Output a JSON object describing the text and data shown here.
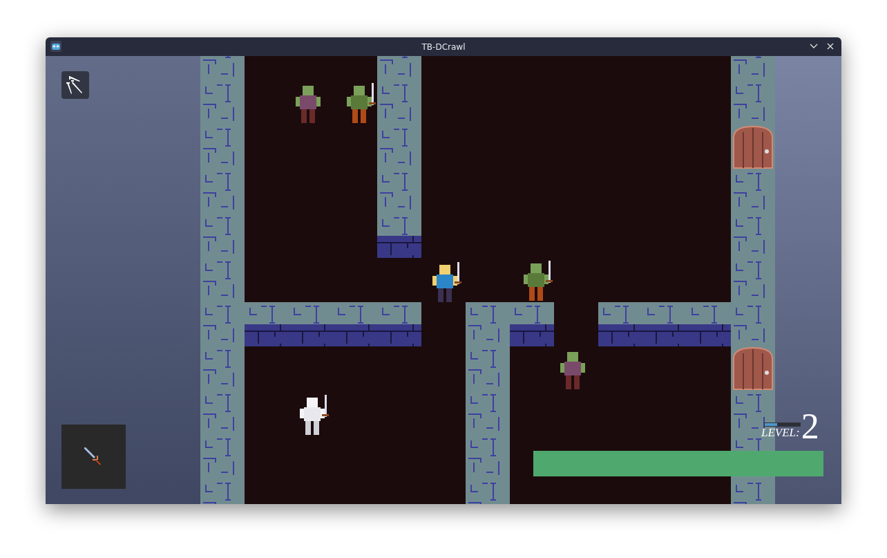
{
  "window": {
    "title": "TB-DCrawl"
  },
  "hud": {
    "level_label": "LEVEL:",
    "level_value": "2",
    "xp": {
      "level": 0.35
    },
    "health": {
      "level": 1
    }
  }
}
